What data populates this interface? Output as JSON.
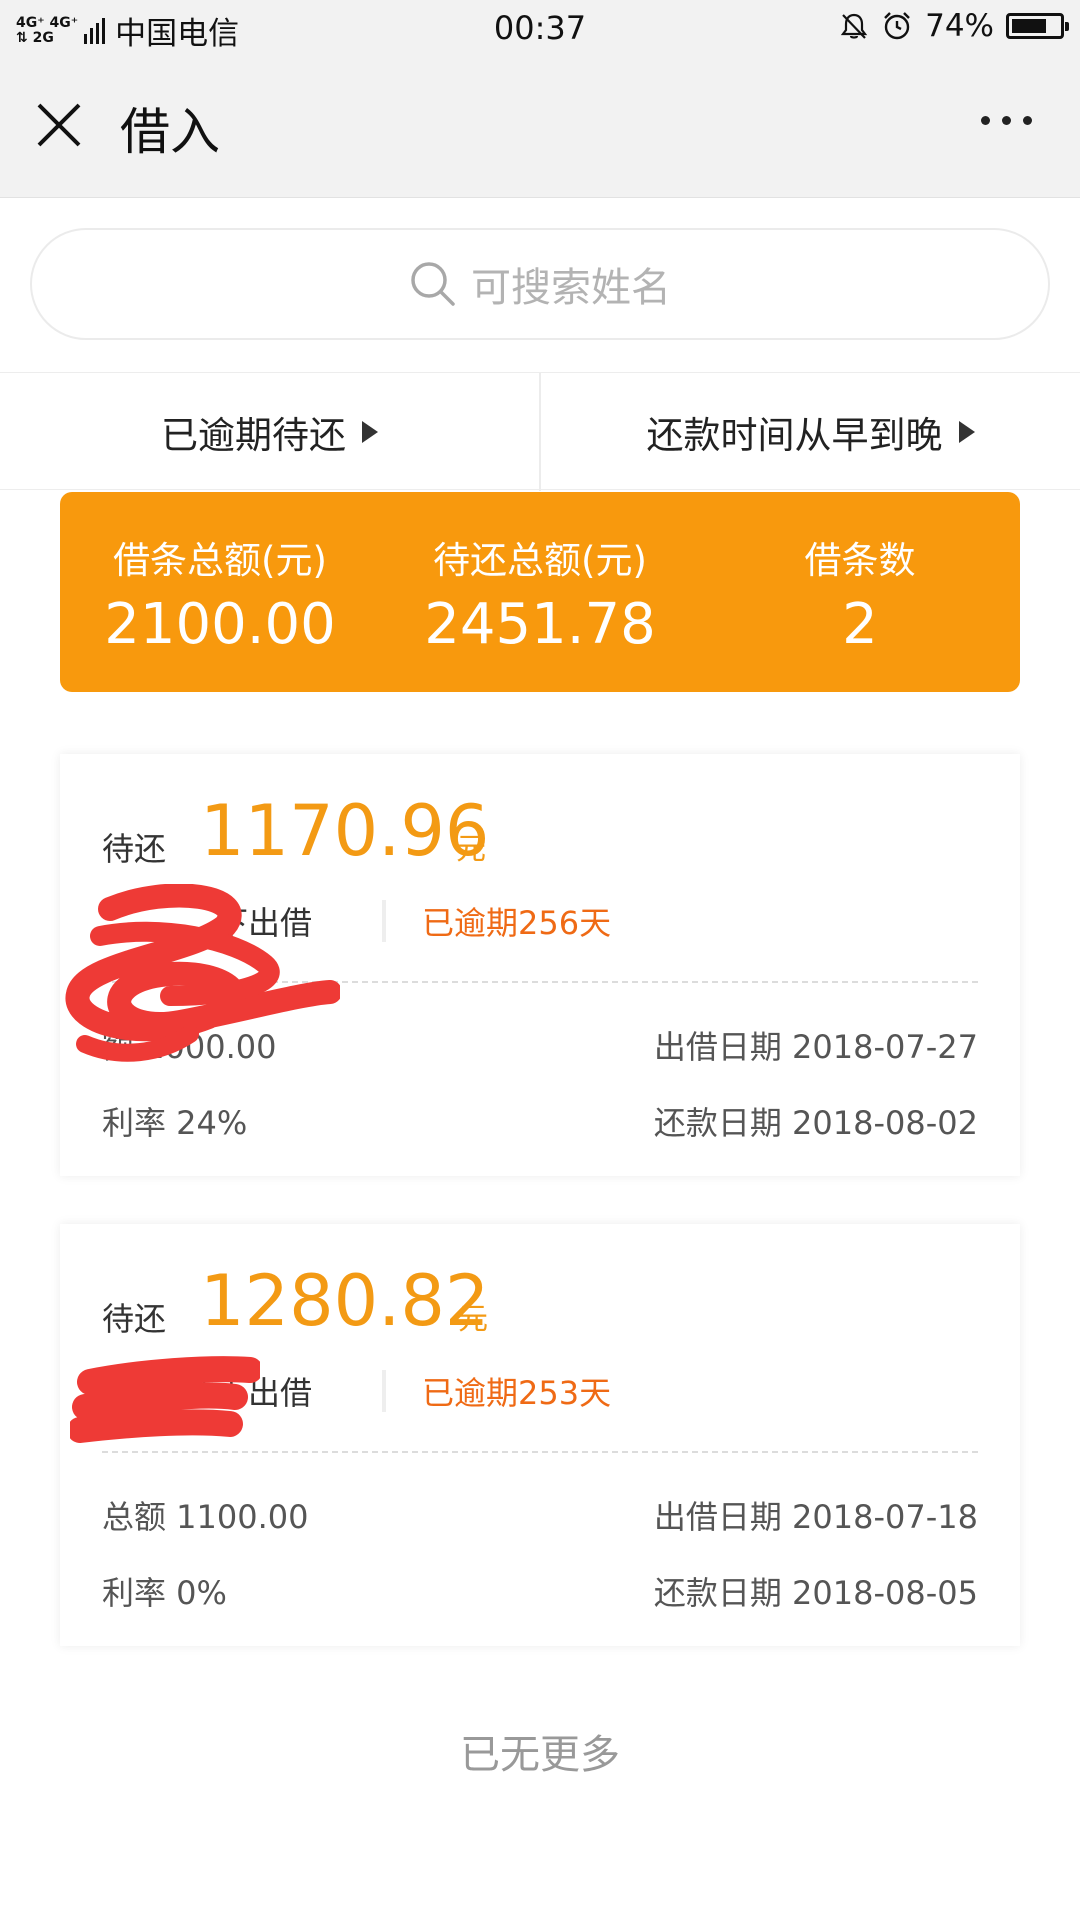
{
  "status_bar": {
    "network_top": "4G⁺ 4G⁺",
    "network_bottom": "⇅ 2G",
    "carrier": "中国电信",
    "time": "00:37",
    "battery": "74%",
    "battery_fraction": 0.74,
    "icons": [
      "silent-bell-icon",
      "alarm-clock-icon",
      "battery-icon"
    ]
  },
  "nav": {
    "title": "借入",
    "close_icon": "close-icon",
    "more_icon": "more-icon"
  },
  "search": {
    "placeholder": "可搜索姓名",
    "icon": "search-icon"
  },
  "filters": {
    "status": "已逾期待还",
    "sort": "还款时间从早到晚"
  },
  "summary": {
    "total_label": "借条总额(元)",
    "total_value": "2100.00",
    "pending_label": "待还总额(元)",
    "pending_value": "2451.78",
    "count_label": "借条数",
    "count_value": "2"
  },
  "loans": [
    {
      "due_label": "待还",
      "due_amount": "1170.96",
      "unit": "元",
      "type": "下出借",
      "overdue": "已逾期256天",
      "total": "额 1000.00",
      "lend_date": "出借日期 2018-07-27",
      "rate": "利率 24%",
      "repay_date": "还款日期 2018-08-02"
    },
    {
      "due_label": "待还",
      "due_amount": "1280.82",
      "unit": "元",
      "type": "线下出借",
      "overdue": "已逾期253天",
      "total": "总额 1100.00",
      "lend_date": "出借日期 2018-07-18",
      "rate": "利率 0%",
      "repay_date": "还款日期 2018-08-05"
    }
  ],
  "footer": {
    "no_more": "已无更多"
  },
  "colors": {
    "accent_orange": "#f8990d",
    "amount_orange": "#f39a14",
    "overdue_orange": "#ef6a15",
    "redaction_red": "#ee3a36",
    "header_bg": "#f2f2f2"
  }
}
